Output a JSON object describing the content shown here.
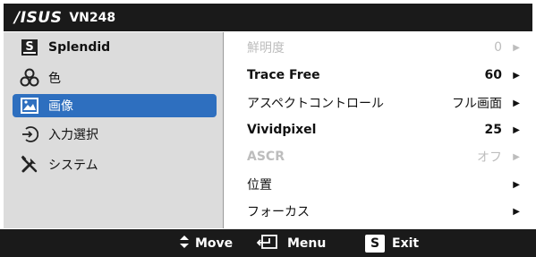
{
  "title": {
    "brand": "/ISUS",
    "model": "VN248"
  },
  "sidebar": {
    "items": [
      {
        "label": "Splendid"
      },
      {
        "label": "色"
      },
      {
        "label": "画像"
      },
      {
        "label": "入力選択"
      },
      {
        "label": "システム"
      }
    ]
  },
  "rows": [
    {
      "label": "鮮明度",
      "value": "0",
      "arrow": "▶",
      "disabled": true
    },
    {
      "label": "Trace Free",
      "value": "60",
      "arrow": "▶",
      "bold": true
    },
    {
      "label": "アスペクトコントロール",
      "value": "フル画面",
      "arrow": "▶"
    },
    {
      "label": "Vividpixel",
      "value": "25",
      "arrow": "▶",
      "bold": true
    },
    {
      "label": "ASCR",
      "value": "オフ",
      "arrow": "▶",
      "disabled": true,
      "bold": true
    },
    {
      "label": "位置",
      "value": "",
      "arrow": "▶"
    },
    {
      "label": "フォーカス",
      "value": "",
      "arrow": "▶"
    }
  ],
  "bottom": {
    "move": "Move",
    "menu": "Menu",
    "exit": "Exit",
    "exit_key": "S",
    "menu_icon": "enter-icon",
    "move_icon": "up-down-arrows-icon"
  },
  "colors": {
    "selected": "#2e6fbf",
    "bar": "#1a1a1a",
    "sidebar_bg": "#dcdcdc",
    "disabled_text": "#bdbdbd"
  }
}
